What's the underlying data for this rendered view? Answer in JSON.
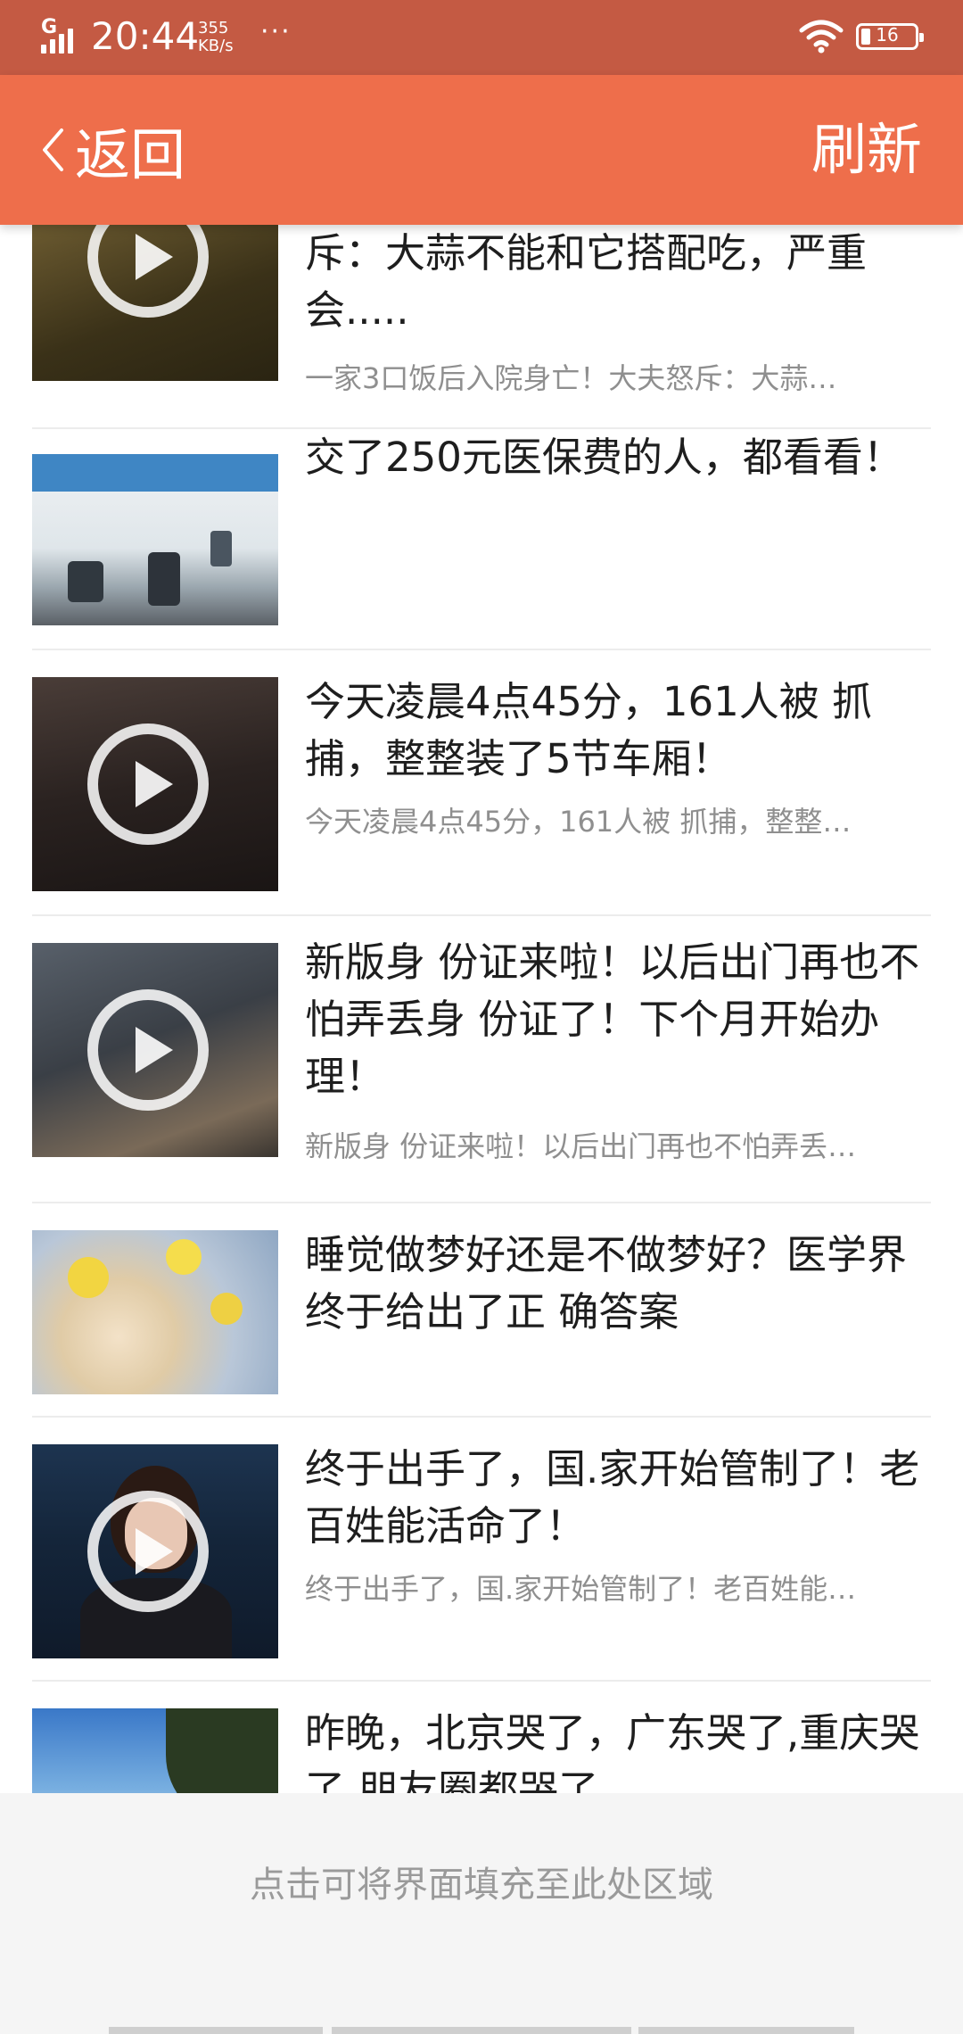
{
  "status_bar": {
    "network": "G",
    "time": "20:44",
    "speed_value": "355",
    "speed_unit": "KB/s",
    "more": "···",
    "battery": "16"
  },
  "nav": {
    "back_label": "返回",
    "refresh_label": "刷新"
  },
  "articles": [
    {
      "title": "斥：大蒜不能和它搭配吃，严重会.....",
      "desc": "一家3口饭后入院身亡！大夫怒斥：大蒜…",
      "video": true
    },
    {
      "title": "交了250元医保费的人，都看看！",
      "desc": "",
      "video": false
    },
    {
      "title": "今天凌晨4点45分，161人被 抓捕，整整装了5节车厢！",
      "desc": "今天凌晨4点45分，161人被 抓捕，整整…",
      "video": true
    },
    {
      "title": "新版身 份证来啦！以后出门再也不怕弄丢身 份证了！下个月开始办理！",
      "desc": "新版身 份证来啦！以后出门再也不怕弄丢…",
      "video": true
    },
    {
      "title": "睡觉做梦好还是不做梦好？医学界终于给出了正 确答案",
      "desc": "",
      "video": false
    },
    {
      "title": "终于出手了，国.家开始管制了！老百姓能活命了！",
      "desc": "终于出手了，国.家开始管制了！老百姓能…",
      "video": true
    },
    {
      "title": "昨晚，北京哭了，广东哭了,重庆哭了,朋友圈都哭了",
      "desc": "",
      "video": false
    }
  ],
  "fill_area": {
    "hint": "点击可将界面填充至此处区域"
  }
}
